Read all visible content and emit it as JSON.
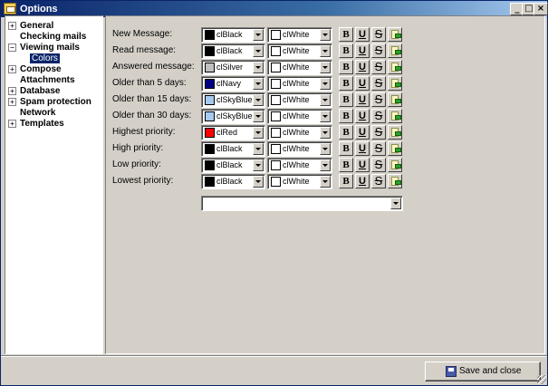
{
  "window": {
    "title": "Options",
    "controls": {
      "minimize": "_",
      "maximize": "□",
      "close": "×"
    }
  },
  "tree": {
    "items": [
      {
        "label": "General",
        "expander": "+"
      },
      {
        "label": "Checking mails",
        "expander": ""
      },
      {
        "label": "Viewing mails",
        "expander": "−"
      },
      {
        "label": "Colors",
        "expander": "",
        "selected": true
      },
      {
        "label": "Compose",
        "expander": "+"
      },
      {
        "label": "Attachments",
        "expander": ""
      },
      {
        "label": "Database",
        "expander": "+"
      },
      {
        "label": "Spam protection",
        "expander": "+"
      },
      {
        "label": "Network",
        "expander": ""
      },
      {
        "label": "Templates",
        "expander": "+"
      }
    ]
  },
  "styles": {
    "bold_label": "B",
    "underline_label": "U",
    "strike_label": "S"
  },
  "rows": [
    {
      "label": "New Message:",
      "text_color": "clBlack",
      "text_hex": "#000000",
      "bg_color": "clWhite",
      "bg_hex": "#ffffff"
    },
    {
      "label": "Read message:",
      "text_color": "clBlack",
      "text_hex": "#000000",
      "bg_color": "clWhite",
      "bg_hex": "#ffffff"
    },
    {
      "label": "Answered message:",
      "text_color": "clSilver",
      "text_hex": "#c0c0c0",
      "bg_color": "clWhite",
      "bg_hex": "#ffffff"
    },
    {
      "label": "Older than 5 days:",
      "text_color": "clNavy",
      "text_hex": "#000080",
      "bg_color": "clWhite",
      "bg_hex": "#ffffff"
    },
    {
      "label": "Older than 15 days:",
      "text_color": "clSkyBlue",
      "text_hex": "#a6caf0",
      "bg_color": "clWhite",
      "bg_hex": "#ffffff"
    },
    {
      "label": "Older than 30 days:",
      "text_color": "clSkyBlue",
      "text_hex": "#a6caf0",
      "bg_color": "clWhite",
      "bg_hex": "#ffffff"
    },
    {
      "label": "Highest priority:",
      "text_color": "clRed",
      "text_hex": "#ff0000",
      "bg_color": "clWhite",
      "bg_hex": "#ffffff"
    },
    {
      "label": "High priority:",
      "text_color": "clBlack",
      "text_hex": "#000000",
      "bg_color": "clWhite",
      "bg_hex": "#ffffff"
    },
    {
      "label": "Low priority:",
      "text_color": "clBlack",
      "text_hex": "#000000",
      "bg_color": "clWhite",
      "bg_hex": "#ffffff"
    },
    {
      "label": "Lowest priority:",
      "text_color": "clBlack",
      "text_hex": "#000000",
      "bg_color": "clWhite",
      "bg_hex": "#ffffff"
    }
  ],
  "font_select": {
    "value": ""
  },
  "footer": {
    "save_label": "Save and close",
    "save_icon": "floppy-disk-icon"
  }
}
